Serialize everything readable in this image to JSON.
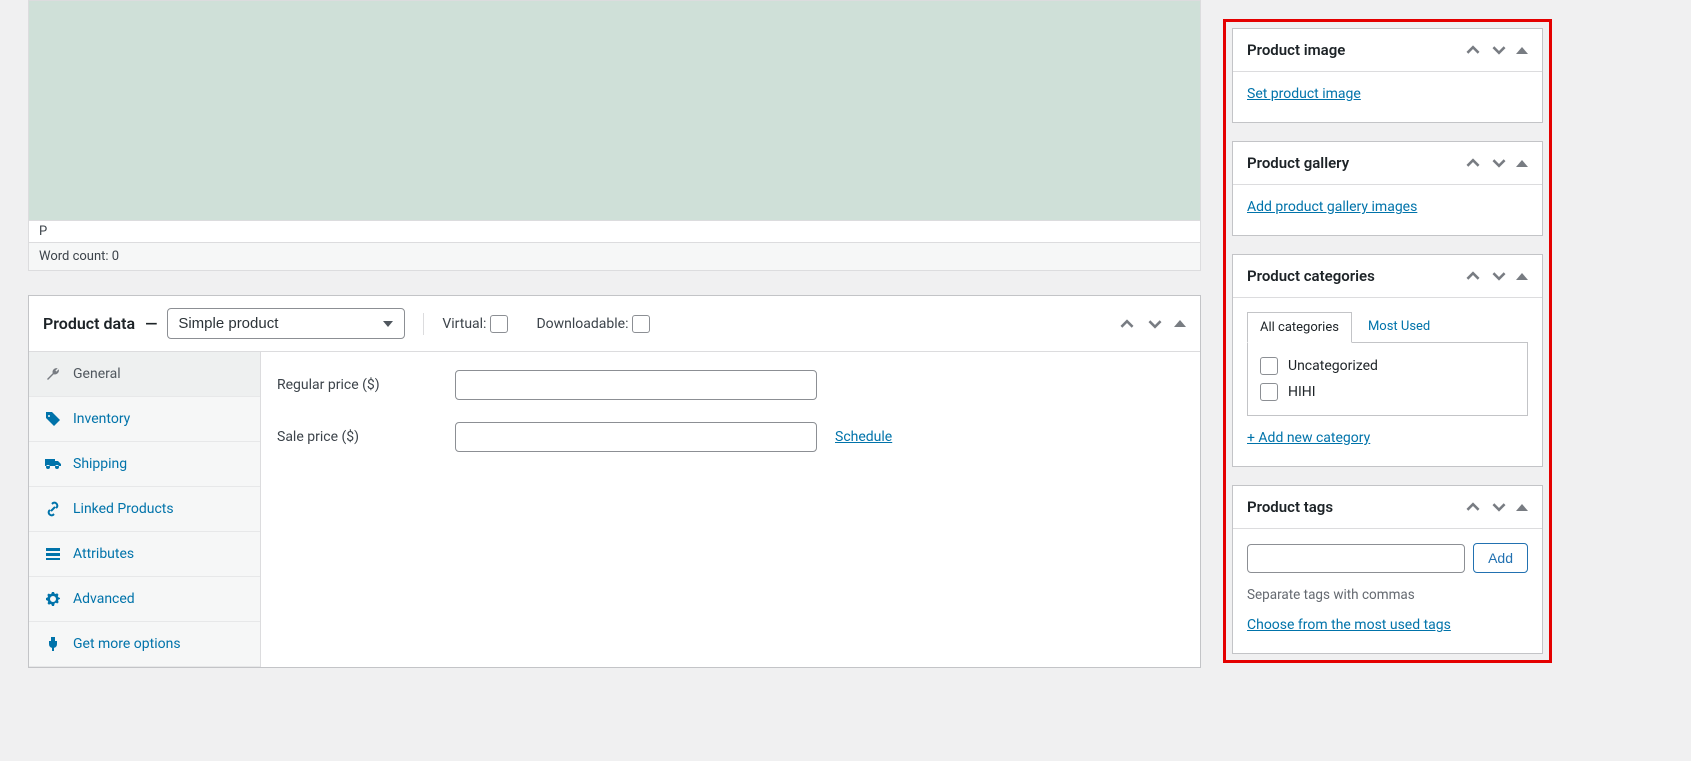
{
  "editor": {
    "path": "P",
    "wordcount_label": "Word count: 0"
  },
  "product_data": {
    "title": "Product data",
    "sep": "—",
    "type_selected": "Simple product",
    "virtual_label": "Virtual:",
    "downloadable_label": "Downloadable:",
    "tabs": {
      "general": "General",
      "inventory": "Inventory",
      "shipping": "Shipping",
      "linked": "Linked Products",
      "attributes": "Attributes",
      "advanced": "Advanced",
      "more": "Get more options"
    },
    "fields": {
      "regular_price_label": "Regular price ($)",
      "sale_price_label": "Sale price ($)",
      "schedule_link": "Schedule"
    }
  },
  "sidebar": {
    "product_image": {
      "title": "Product image",
      "link": "Set product image"
    },
    "product_gallery": {
      "title": "Product gallery",
      "link": "Add product gallery images"
    },
    "categories": {
      "title": "Product categories",
      "tab_all": "All categories",
      "tab_most": "Most Used",
      "items": [
        "Uncategorized",
        "HIHI"
      ],
      "add_link": "+ Add new category"
    },
    "tags": {
      "title": "Product tags",
      "add_btn": "Add",
      "hint": "Separate tags with commas",
      "popular_link": "Choose from the most used tags"
    }
  }
}
